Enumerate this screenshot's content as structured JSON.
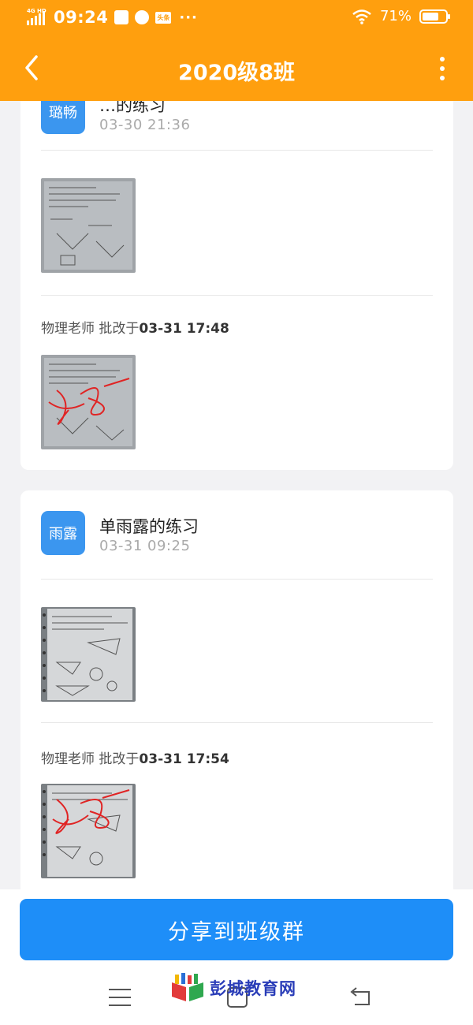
{
  "status_bar": {
    "network": "4G HD",
    "time": "09:24",
    "battery_percent": "71%",
    "battery_level": 0.71,
    "icons": [
      "signal-icon",
      "calendar-icon",
      "compass-icon",
      "app-icon",
      "more-dots",
      "wifi-icon",
      "battery-icon"
    ],
    "app_badge": "头条",
    "dots": "···"
  },
  "header": {
    "title": "2020级8班"
  },
  "submissions": [
    {
      "avatar_text": "璐畅",
      "student_name": "…的练习",
      "time": "03-30 21:36",
      "reviewer": "物理老师",
      "review_prefix": "批改于",
      "review_time": "03-31 17:48"
    },
    {
      "avatar_text": "雨露",
      "student_name": "单雨露的练习",
      "time": "03-31 09:25",
      "reviewer": "物理老师",
      "review_prefix": "批改于",
      "review_time": "03-31 17:54"
    }
  ],
  "bottom": {
    "share_label": "分享到班级群"
  },
  "watermark": {
    "text": "彭城教育网"
  },
  "colors": {
    "accent": "#ff9f0e",
    "primary_button": "#1e8ef8",
    "avatar": "#3b96ef"
  }
}
